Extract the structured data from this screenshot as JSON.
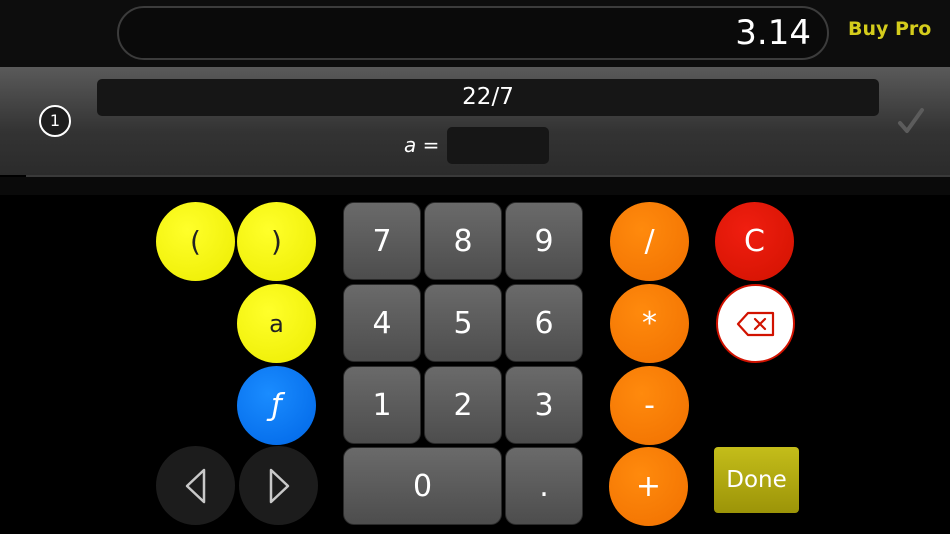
{
  "header": {
    "result": "3.14",
    "buy_pro": "Buy Pro"
  },
  "expression": {
    "index": "1",
    "text": "22/7",
    "var_label": "a =",
    "var_value": ""
  },
  "keypad": {
    "paren_open": "(",
    "paren_close": ")",
    "var_a": "a",
    "func": "ƒ",
    "digits": [
      "0",
      "1",
      "2",
      "3",
      "4",
      "5",
      "6",
      "7",
      "8",
      "9"
    ],
    "dot": ".",
    "divide": "/",
    "multiply": "*",
    "minus": "-",
    "plus": "+",
    "clear": "C",
    "done": "Done"
  },
  "colors": {
    "yellow": "#f5f500",
    "orange": "#f97d00",
    "blue": "#0a78f5",
    "red": "#e01800",
    "done": "#b3ab12",
    "buy_pro": "#d4cc1c"
  }
}
